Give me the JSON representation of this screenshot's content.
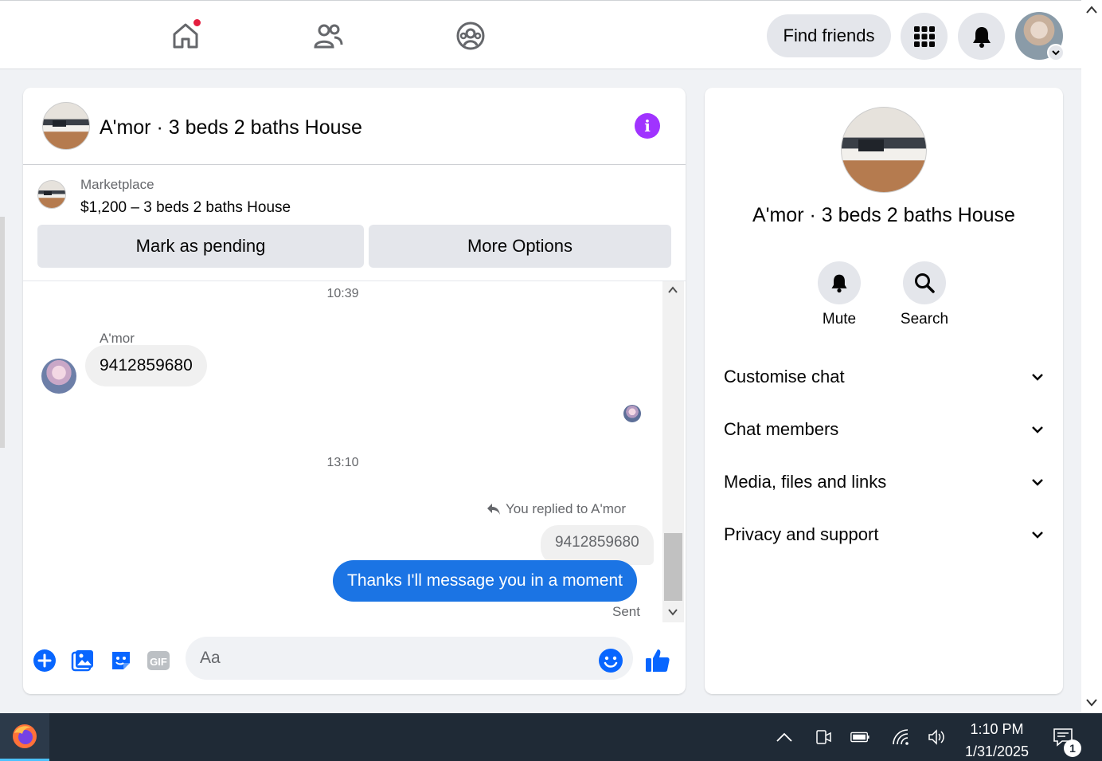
{
  "nav": {
    "find_friends_label": "Find friends"
  },
  "chat": {
    "title": "A'mor · 3 beds 2 baths House",
    "marketplace": {
      "label": "Marketplace",
      "listing": "$1,200 – 3 beds 2 baths House"
    },
    "buttons": {
      "mark_pending": "Mark as pending",
      "more_options": "More Options"
    },
    "messages": {
      "time_1": "10:39",
      "sender": "A'mor",
      "incoming_text": "9412859680",
      "time_2": "13:10",
      "replied_to": "You replied to A'mor",
      "quoted_text": "9412859680",
      "outgoing_text": "Thanks I'll message you in a moment",
      "status": "Sent"
    },
    "composer": {
      "placeholder": "Aa"
    }
  },
  "info_panel": {
    "title": "A'mor · 3 beds 2 baths House",
    "actions": {
      "mute": "Mute",
      "search": "Search"
    },
    "sections": [
      "Customise chat",
      "Chat members",
      "Media, files and links",
      "Privacy and support"
    ]
  },
  "taskbar": {
    "time": "1:10 PM",
    "date": "1/31/2025",
    "notification_count": "1"
  },
  "colors": {
    "accent_blue": "#1b74e4",
    "info_purple": "#a033ff",
    "notification_red": "#e41e3f"
  }
}
